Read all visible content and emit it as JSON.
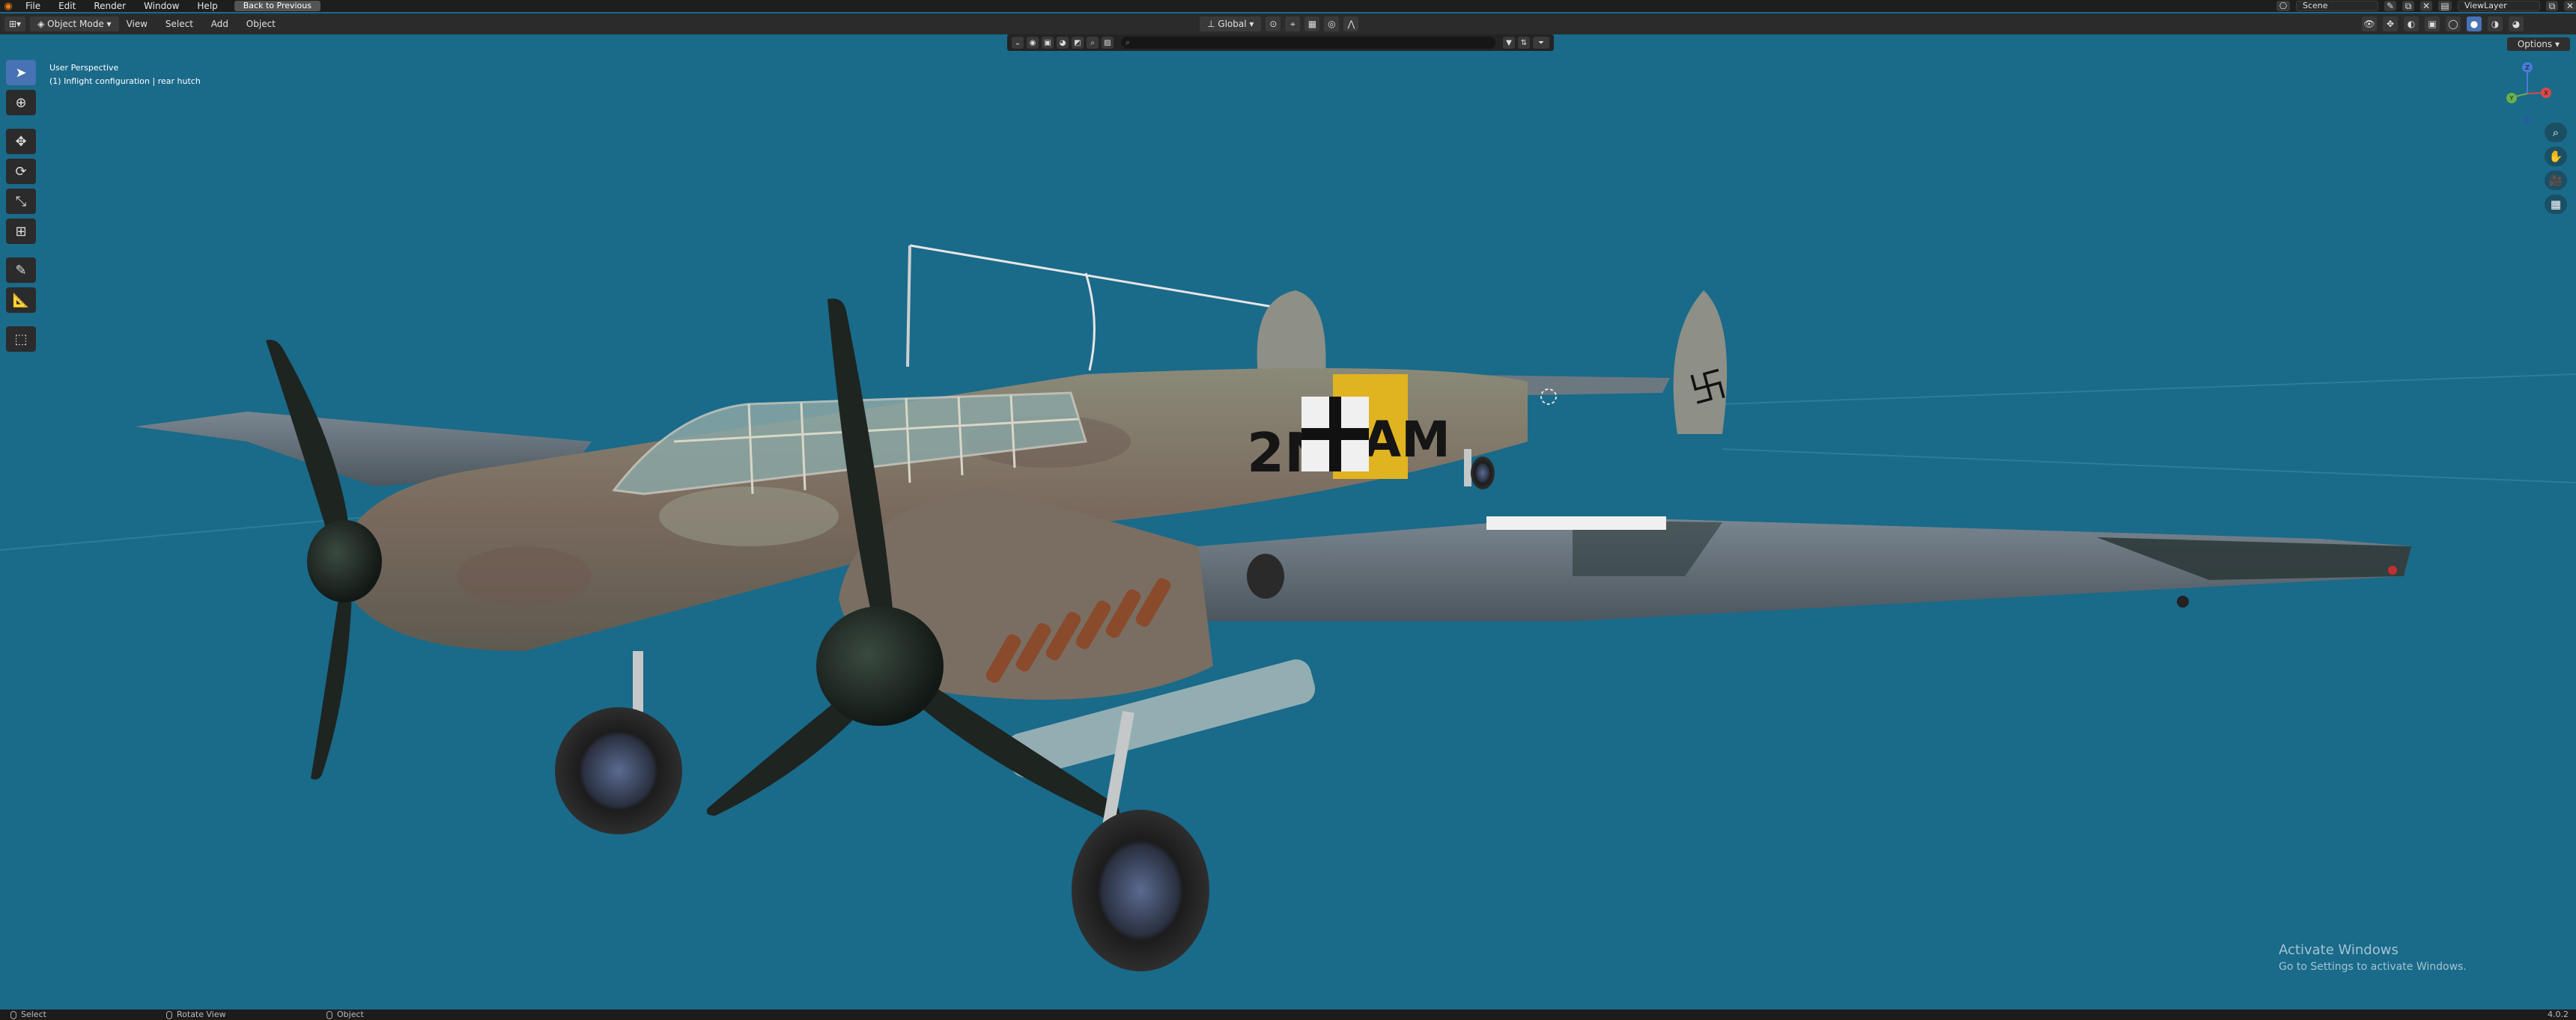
{
  "topbar": {
    "logo": "blender-logo",
    "menu": [
      "File",
      "Edit",
      "Render",
      "Window",
      "Help"
    ],
    "back_button": "Back to Previous",
    "scene": "Scene",
    "view_layer": "ViewLayer"
  },
  "header": {
    "mode": "Object Mode",
    "menu": [
      "View",
      "Select",
      "Add",
      "Object"
    ],
    "orientation": "Global",
    "options": "Options"
  },
  "viewport": {
    "perspective": "User Perspective",
    "collection": "(1) Inflight configuration | rear hutch"
  },
  "aircraft": {
    "code_left": "2N",
    "code_right": "AM"
  },
  "gizmo": {
    "z": "Z",
    "y": "Y",
    "x": "X"
  },
  "watermark": {
    "title": "Activate Windows",
    "subtitle": "Go to Settings to activate Windows."
  },
  "statusbar": {
    "select": "Select",
    "rotate": "Rotate View",
    "object": "Object",
    "version": "4.0.2"
  },
  "colors": {
    "viewport_bg": "#1a6a8a",
    "accent": "#4772b3",
    "yellow_band": "#e0b320"
  }
}
